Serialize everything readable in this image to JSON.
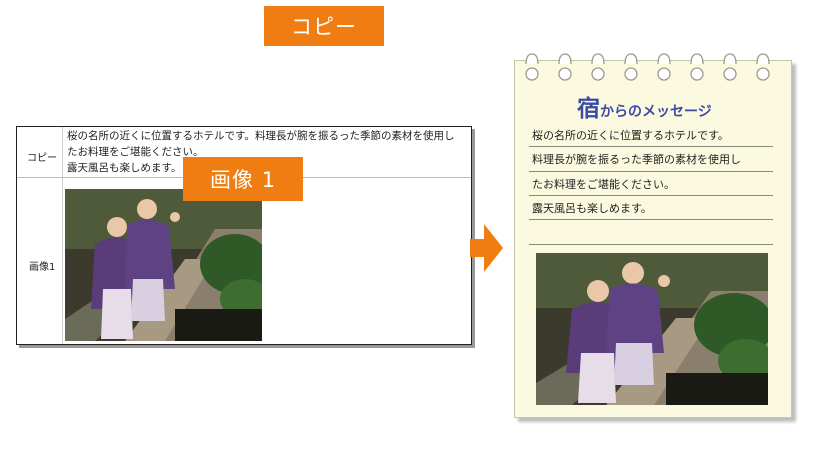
{
  "admin_form": {
    "copy_label": "コピー",
    "image_label": "画像1",
    "copy_lines": [
      "桜の名所の近くに位置するホテルです。料理長が腕を振るった季節の素材を使用し",
      "たお料理をご堪能ください。",
      "露天風呂も楽しめます。"
    ]
  },
  "callouts": {
    "copy": "コピー",
    "image": "画像 1"
  },
  "preview": {
    "title_big": "宿",
    "title_rest": "からのメッセージ",
    "lines": [
      "桜の名所の近くに位置するホテルです。",
      "料理長が腕を振るった季節の素材を使用し",
      "たお料理をご堪能ください。",
      "露天風呂も楽しめます。"
    ]
  },
  "colors": {
    "callout": "#ef7d11",
    "arrow": "#ef7d11",
    "title": "#3c4aa5",
    "notepad": "#fbfae0"
  },
  "icons": {
    "arrow": "arrow-right-icon",
    "rings": "spiral-ring-icon"
  },
  "images": {
    "photo": "two women in purple yukata waving on garden steps"
  }
}
